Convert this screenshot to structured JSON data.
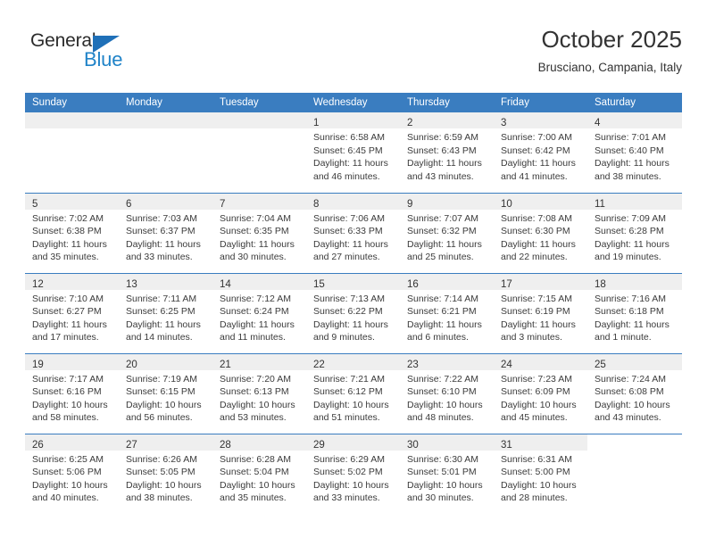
{
  "brand": {
    "name_top": "General",
    "name_bottom": "Blue",
    "triangle_color": "#1f70b8",
    "blue_text_color": "#2083c8"
  },
  "header": {
    "title": "October 2025",
    "subtitle": "Brusciano, Campania, Italy"
  },
  "theme": {
    "header_row_bg": "#3a7dc0",
    "daynum_band_bg": "#efefef",
    "row_divider": "#3a7dc0",
    "text": "#333333"
  },
  "weekday_headers": [
    "Sunday",
    "Monday",
    "Tuesday",
    "Wednesday",
    "Thursday",
    "Friday",
    "Saturday"
  ],
  "labels": {
    "sunrise": "Sunrise:",
    "sunset": "Sunset:",
    "daylight": "Daylight:"
  },
  "weeks": [
    [
      {
        "day": "",
        "blank": true
      },
      {
        "day": "",
        "blank": true
      },
      {
        "day": "",
        "blank": true
      },
      {
        "day": "1",
        "sunrise": "Sunrise: 6:58 AM",
        "sunset": "Sunset: 6:45 PM",
        "daylight1": "Daylight: 11 hours",
        "daylight2": "and 46 minutes."
      },
      {
        "day": "2",
        "sunrise": "Sunrise: 6:59 AM",
        "sunset": "Sunset: 6:43 PM",
        "daylight1": "Daylight: 11 hours",
        "daylight2": "and 43 minutes."
      },
      {
        "day": "3",
        "sunrise": "Sunrise: 7:00 AM",
        "sunset": "Sunset: 6:42 PM",
        "daylight1": "Daylight: 11 hours",
        "daylight2": "and 41 minutes."
      },
      {
        "day": "4",
        "sunrise": "Sunrise: 7:01 AM",
        "sunset": "Sunset: 6:40 PM",
        "daylight1": "Daylight: 11 hours",
        "daylight2": "and 38 minutes."
      }
    ],
    [
      {
        "day": "5",
        "sunrise": "Sunrise: 7:02 AM",
        "sunset": "Sunset: 6:38 PM",
        "daylight1": "Daylight: 11 hours",
        "daylight2": "and 35 minutes."
      },
      {
        "day": "6",
        "sunrise": "Sunrise: 7:03 AM",
        "sunset": "Sunset: 6:37 PM",
        "daylight1": "Daylight: 11 hours",
        "daylight2": "and 33 minutes."
      },
      {
        "day": "7",
        "sunrise": "Sunrise: 7:04 AM",
        "sunset": "Sunset: 6:35 PM",
        "daylight1": "Daylight: 11 hours",
        "daylight2": "and 30 minutes."
      },
      {
        "day": "8",
        "sunrise": "Sunrise: 7:06 AM",
        "sunset": "Sunset: 6:33 PM",
        "daylight1": "Daylight: 11 hours",
        "daylight2": "and 27 minutes."
      },
      {
        "day": "9",
        "sunrise": "Sunrise: 7:07 AM",
        "sunset": "Sunset: 6:32 PM",
        "daylight1": "Daylight: 11 hours",
        "daylight2": "and 25 minutes."
      },
      {
        "day": "10",
        "sunrise": "Sunrise: 7:08 AM",
        "sunset": "Sunset: 6:30 PM",
        "daylight1": "Daylight: 11 hours",
        "daylight2": "and 22 minutes."
      },
      {
        "day": "11",
        "sunrise": "Sunrise: 7:09 AM",
        "sunset": "Sunset: 6:28 PM",
        "daylight1": "Daylight: 11 hours",
        "daylight2": "and 19 minutes."
      }
    ],
    [
      {
        "day": "12",
        "sunrise": "Sunrise: 7:10 AM",
        "sunset": "Sunset: 6:27 PM",
        "daylight1": "Daylight: 11 hours",
        "daylight2": "and 17 minutes."
      },
      {
        "day": "13",
        "sunrise": "Sunrise: 7:11 AM",
        "sunset": "Sunset: 6:25 PM",
        "daylight1": "Daylight: 11 hours",
        "daylight2": "and 14 minutes."
      },
      {
        "day": "14",
        "sunrise": "Sunrise: 7:12 AM",
        "sunset": "Sunset: 6:24 PM",
        "daylight1": "Daylight: 11 hours",
        "daylight2": "and 11 minutes."
      },
      {
        "day": "15",
        "sunrise": "Sunrise: 7:13 AM",
        "sunset": "Sunset: 6:22 PM",
        "daylight1": "Daylight: 11 hours",
        "daylight2": "and 9 minutes."
      },
      {
        "day": "16",
        "sunrise": "Sunrise: 7:14 AM",
        "sunset": "Sunset: 6:21 PM",
        "daylight1": "Daylight: 11 hours",
        "daylight2": "and 6 minutes."
      },
      {
        "day": "17",
        "sunrise": "Sunrise: 7:15 AM",
        "sunset": "Sunset: 6:19 PM",
        "daylight1": "Daylight: 11 hours",
        "daylight2": "and 3 minutes."
      },
      {
        "day": "18",
        "sunrise": "Sunrise: 7:16 AM",
        "sunset": "Sunset: 6:18 PM",
        "daylight1": "Daylight: 11 hours",
        "daylight2": "and 1 minute."
      }
    ],
    [
      {
        "day": "19",
        "sunrise": "Sunrise: 7:17 AM",
        "sunset": "Sunset: 6:16 PM",
        "daylight1": "Daylight: 10 hours",
        "daylight2": "and 58 minutes."
      },
      {
        "day": "20",
        "sunrise": "Sunrise: 7:19 AM",
        "sunset": "Sunset: 6:15 PM",
        "daylight1": "Daylight: 10 hours",
        "daylight2": "and 56 minutes."
      },
      {
        "day": "21",
        "sunrise": "Sunrise: 7:20 AM",
        "sunset": "Sunset: 6:13 PM",
        "daylight1": "Daylight: 10 hours",
        "daylight2": "and 53 minutes."
      },
      {
        "day": "22",
        "sunrise": "Sunrise: 7:21 AM",
        "sunset": "Sunset: 6:12 PM",
        "daylight1": "Daylight: 10 hours",
        "daylight2": "and 51 minutes."
      },
      {
        "day": "23",
        "sunrise": "Sunrise: 7:22 AM",
        "sunset": "Sunset: 6:10 PM",
        "daylight1": "Daylight: 10 hours",
        "daylight2": "and 48 minutes."
      },
      {
        "day": "24",
        "sunrise": "Sunrise: 7:23 AM",
        "sunset": "Sunset: 6:09 PM",
        "daylight1": "Daylight: 10 hours",
        "daylight2": "and 45 minutes."
      },
      {
        "day": "25",
        "sunrise": "Sunrise: 7:24 AM",
        "sunset": "Sunset: 6:08 PM",
        "daylight1": "Daylight: 10 hours",
        "daylight2": "and 43 minutes."
      }
    ],
    [
      {
        "day": "26",
        "sunrise": "Sunrise: 6:25 AM",
        "sunset": "Sunset: 5:06 PM",
        "daylight1": "Daylight: 10 hours",
        "daylight2": "and 40 minutes."
      },
      {
        "day": "27",
        "sunrise": "Sunrise: 6:26 AM",
        "sunset": "Sunset: 5:05 PM",
        "daylight1": "Daylight: 10 hours",
        "daylight2": "and 38 minutes."
      },
      {
        "day": "28",
        "sunrise": "Sunrise: 6:28 AM",
        "sunset": "Sunset: 5:04 PM",
        "daylight1": "Daylight: 10 hours",
        "daylight2": "and 35 minutes."
      },
      {
        "day": "29",
        "sunrise": "Sunrise: 6:29 AM",
        "sunset": "Sunset: 5:02 PM",
        "daylight1": "Daylight: 10 hours",
        "daylight2": "and 33 minutes."
      },
      {
        "day": "30",
        "sunrise": "Sunrise: 6:30 AM",
        "sunset": "Sunset: 5:01 PM",
        "daylight1": "Daylight: 10 hours",
        "daylight2": "and 30 minutes."
      },
      {
        "day": "31",
        "sunrise": "Sunrise: 6:31 AM",
        "sunset": "Sunset: 5:00 PM",
        "daylight1": "Daylight: 10 hours",
        "daylight2": "and 28 minutes."
      },
      {
        "day": "",
        "blank": true
      }
    ]
  ]
}
